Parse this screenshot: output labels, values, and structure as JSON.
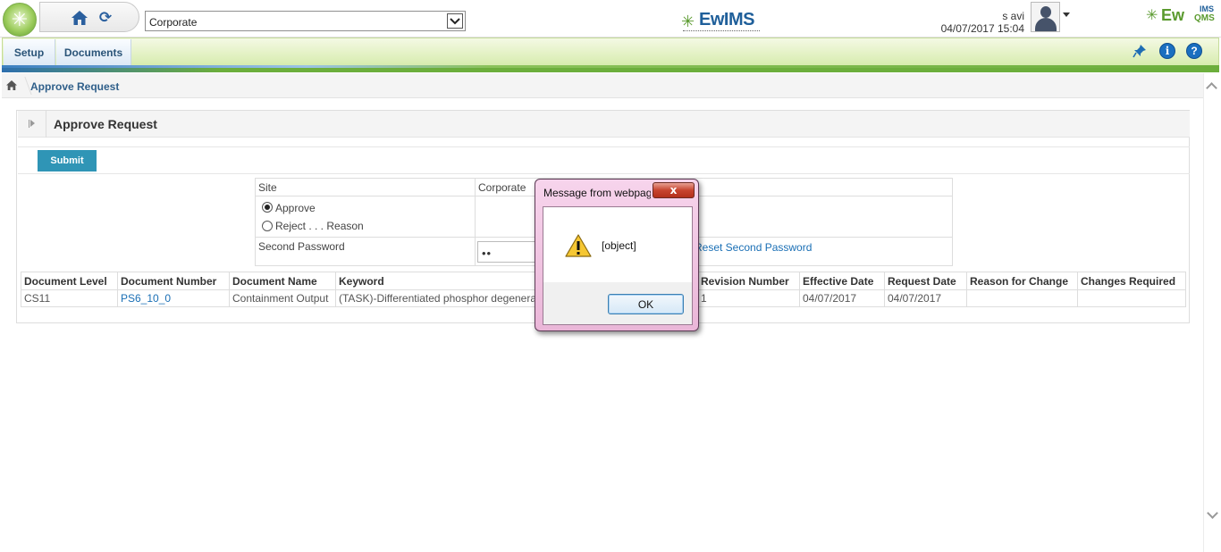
{
  "header": {
    "site_selected": "Corporate",
    "brand_center": "EwIMS",
    "brand_right_main": "Ew",
    "brand_right_ims": "IMS",
    "brand_right_qms": "QMS",
    "user_name": "s avi",
    "datetime": "04/07/2017 15:04"
  },
  "menu": {
    "tabs": [
      {
        "label": "Setup"
      },
      {
        "label": "Documents"
      }
    ],
    "icons": [
      "pin-icon",
      "info-icon",
      "help-icon"
    ]
  },
  "breadcrumb": {
    "current": "Approve Request"
  },
  "panel": {
    "title": "Approve Request",
    "submit_label": "Submit"
  },
  "form": {
    "site_label": "Site",
    "site_value": "Corporate",
    "approve_label": "Approve",
    "reject_label": "Reject . . . Reason",
    "selected_option": "Approve",
    "second_password_label": "Second Password",
    "second_password_value": "••",
    "reset_link": "Reset Second Password"
  },
  "table": {
    "columns": [
      "Document Level",
      "Document Number",
      "Document Name",
      "Keyword",
      "Revision Number",
      "Effective Date",
      "Request Date",
      "Reason for Change",
      "Changes Required"
    ],
    "rows": [
      [
        "CS11",
        "PS6_10_0",
        "Containment Output",
        "(TASK)-Differentiated phosphor degeneration",
        "1",
        "04/07/2017",
        "04/07/2017",
        "",
        ""
      ]
    ]
  },
  "dialog": {
    "title": "Message from webpage",
    "message": "[object]",
    "ok_label": "OK",
    "close_symbol": "x"
  },
  "colors": {
    "accent_blue": "#2f95b6",
    "link_blue": "#1a6fb5",
    "menu_green": "#d7ecae",
    "brand_green": "#5a9a2e",
    "dialog_pink": "#eab6d8"
  }
}
